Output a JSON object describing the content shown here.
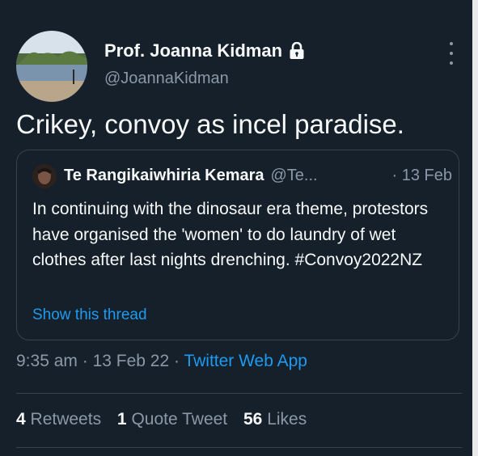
{
  "author": {
    "name": "Prof. Joanna Kidman",
    "handle": "@JoannaKidman",
    "protected_icon": "lock-icon"
  },
  "tweet_text": "Crikey, convoy as incel paradise.",
  "quoted": {
    "name": "Te Rangikaiwhiria Kemara",
    "handle": "@Te...",
    "date": "· 13 Feb",
    "text": "In continuing with the dinosaur era theme, protestors have organised the 'women' to do laundry of wet clothes after last nights drenching. #Convoy2022NZ",
    "show_thread": "Show this thread"
  },
  "meta": {
    "time": "9:35 am",
    "sep": " · ",
    "date": "13 Feb 22",
    "app": "Twitter Web App"
  },
  "stats": {
    "retweets_count": "4",
    "retweets_label": "Retweets",
    "quotes_count": "1",
    "quotes_label": "Quote Tweet",
    "likes_count": "56",
    "likes_label": "Likes"
  },
  "colors": {
    "background": "#15202b",
    "text": "#f7f9f9",
    "secondary": "#8b98a5",
    "link": "#1d9bf0",
    "border": "#38444d"
  }
}
